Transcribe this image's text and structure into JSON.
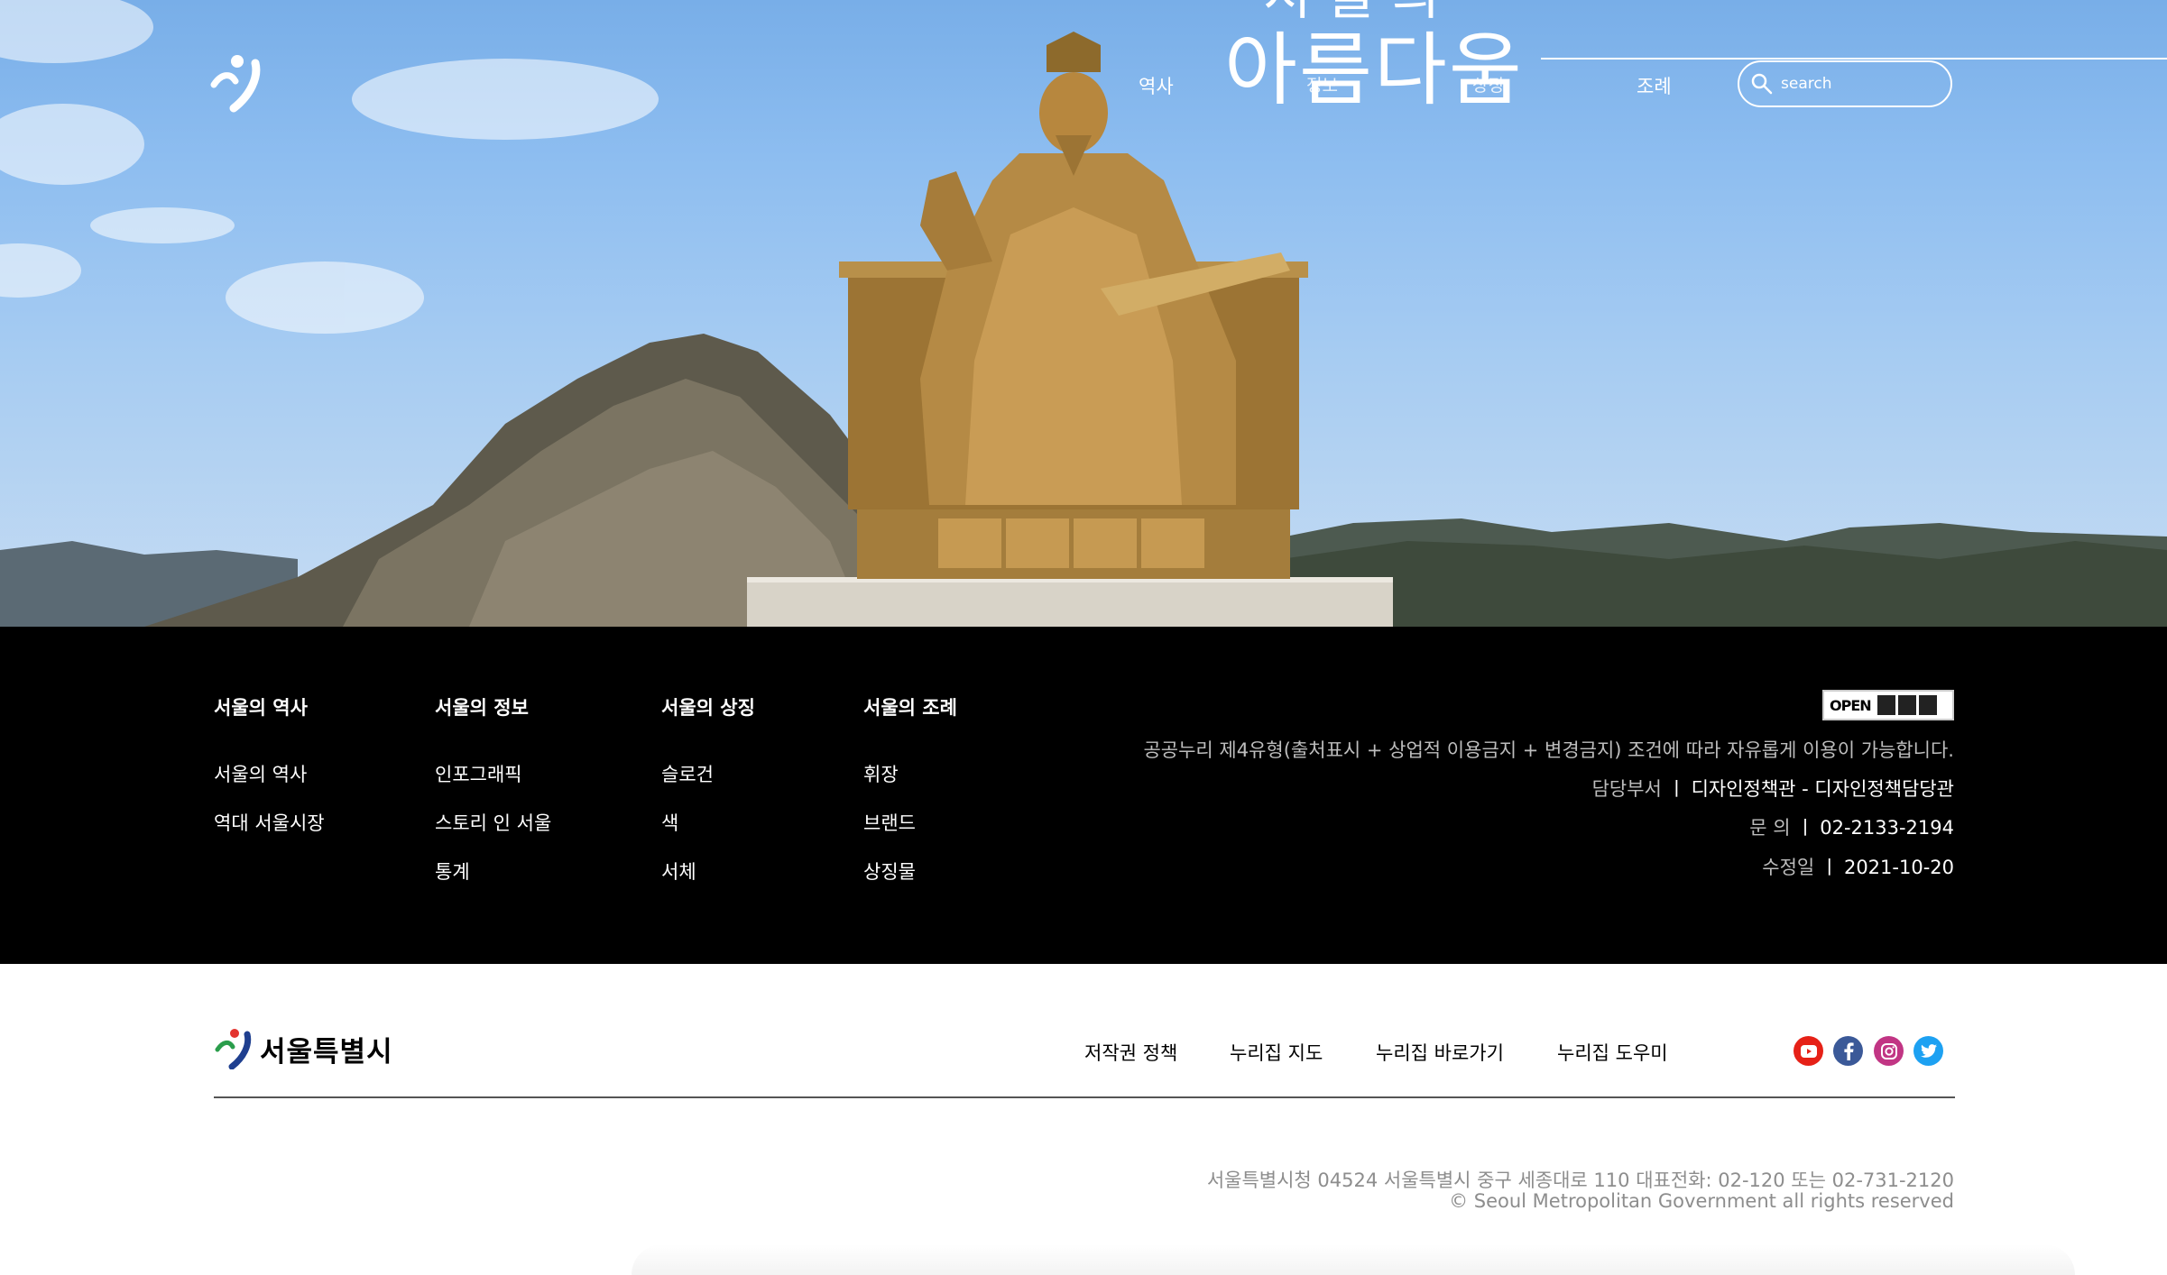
{
  "hero": {
    "big_text_top": "서울의",
    "big_text_main": "아름다움",
    "nav": {
      "history": "역사",
      "info": "정보",
      "symbol": "상징",
      "ceremony": "조례"
    },
    "search": {
      "placeholder": "search"
    }
  },
  "footer_menu": {
    "columns": [
      {
        "heading": "서울의 역사",
        "items": [
          "서울의 역사",
          "역대 서울시장"
        ]
      },
      {
        "heading": "서울의 정보",
        "items": [
          "인포그래픽",
          "스토리 인 서울",
          "통계"
        ]
      },
      {
        "heading": "서울의 상징",
        "items": [
          "슬로건",
          "색",
          "서체"
        ]
      },
      {
        "heading": "서울의 조례",
        "items": [
          "휘장",
          "브랜드",
          "상징물"
        ]
      }
    ],
    "open_badge": "OPEN",
    "license_text": "공공누리 제4유형(출처표시 + 상업적 이용금지 + 변경금지) 조건에 따라 자유롭게 이용이 가능합니다.",
    "department_label": "담당부서",
    "department_value": "디자인정책관 - 디자인정책담당관",
    "inquiry_label": "문 의",
    "inquiry_value": "02-2133-2194",
    "modified_label": "수정일",
    "modified_value": "2021-10-20",
    "separator": "ㅣ"
  },
  "bottom": {
    "logo_text": "서울특별시",
    "links": [
      "저작권 정책",
      "누리집 지도",
      "누리집 바로가기",
      "누리집 도우미"
    ],
    "social": [
      "youtube-icon",
      "facebook-icon",
      "instagram-icon",
      "twitter-icon"
    ],
    "address": "서울특별시청 04524 서울특별시 중구 세종대로 110 대표전화: 02-120 또는 02-731-2120",
    "copyright": "© Seoul Metropolitan Government all rights reserved"
  },
  "colors": {
    "sky": "#8dbdf0",
    "footer_bg": "#000000",
    "youtube": "#e62117",
    "facebook": "#3b5998",
    "instagram": "#c13584",
    "twitter": "#1da1f2"
  }
}
